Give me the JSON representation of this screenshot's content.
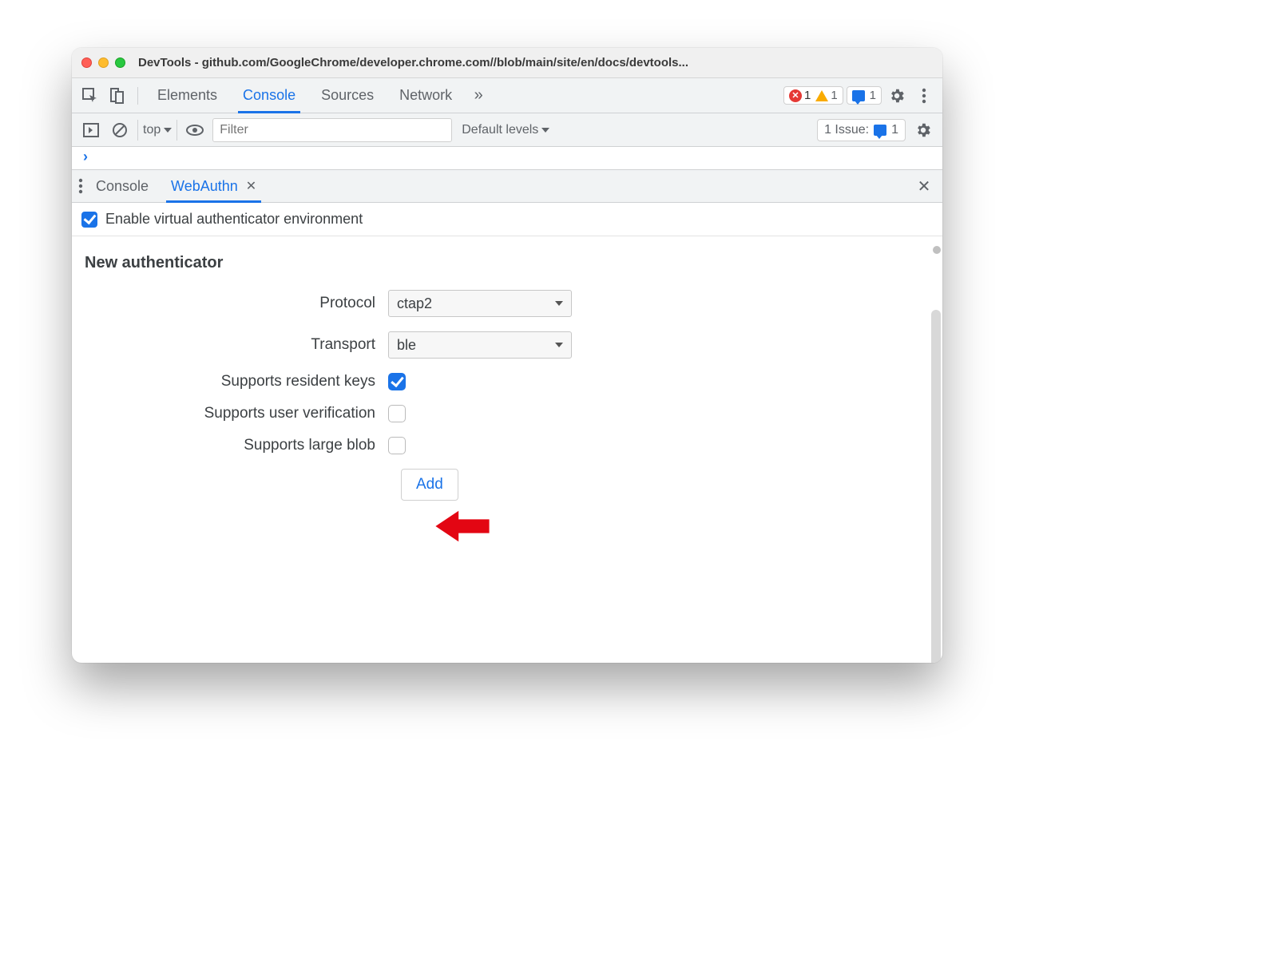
{
  "window": {
    "title": "DevTools - github.com/GoogleChrome/developer.chrome.com//blob/main/site/en/docs/devtools..."
  },
  "tabs": {
    "elements": "Elements",
    "console": "Console",
    "sources": "Sources",
    "network": "Network"
  },
  "badges": {
    "errors": "1",
    "warnings": "1",
    "messages": "1"
  },
  "consoleBar": {
    "context": "top",
    "filter_placeholder": "Filter",
    "levels": "Default levels",
    "issues_label": "1 Issue:",
    "issues_count": "1"
  },
  "drawer": {
    "console": "Console",
    "webauthn": "WebAuthn"
  },
  "enable": {
    "label": "Enable virtual authenticator environment",
    "checked": true
  },
  "form": {
    "title": "New authenticator",
    "protocol_label": "Protocol",
    "protocol_value": "ctap2",
    "transport_label": "Transport",
    "transport_value": "ble",
    "resident_label": "Supports resident keys",
    "resident_checked": true,
    "userverify_label": "Supports user verification",
    "userverify_checked": false,
    "largeblob_label": "Supports large blob",
    "largeblob_checked": false,
    "add_button": "Add"
  }
}
